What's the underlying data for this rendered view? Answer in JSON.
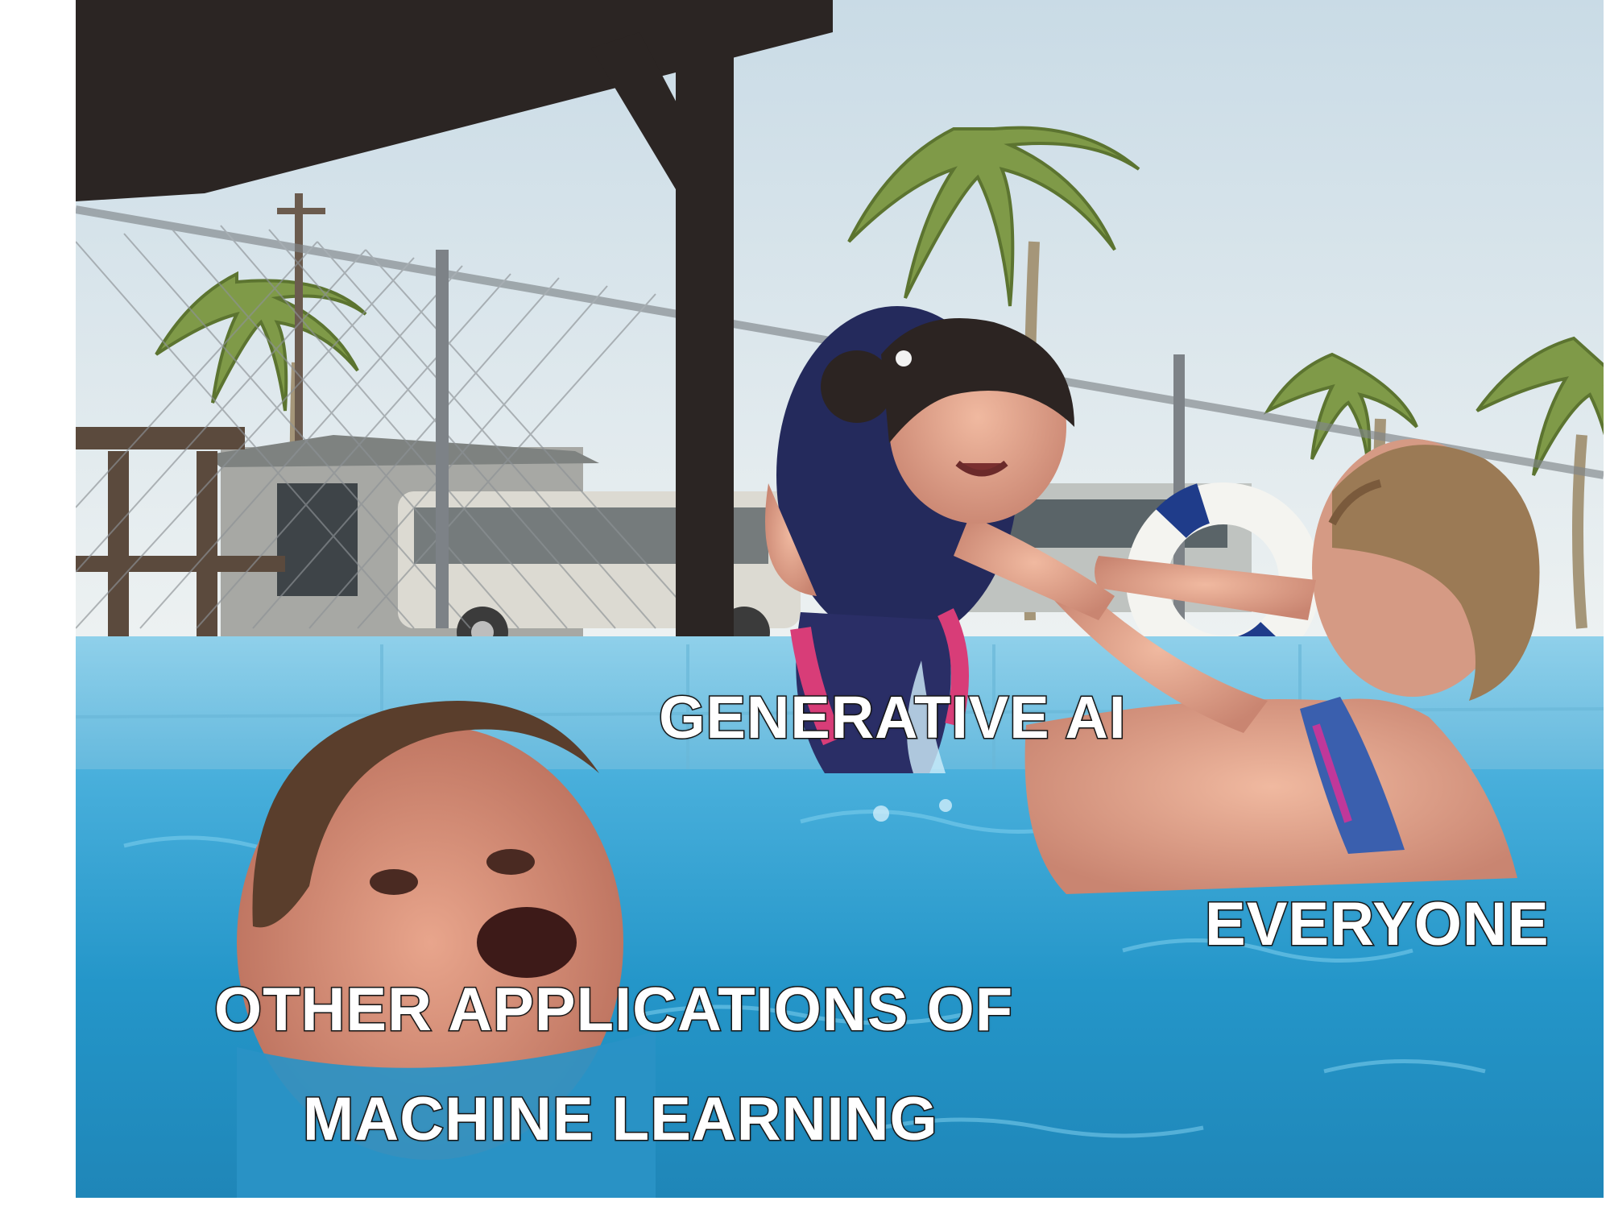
{
  "meme": {
    "captions": {
      "generative_ai": "GENERATIVE AI",
      "everyone": "EVERYONE",
      "other_line1": "OTHER APPLICATIONS OF",
      "other_line2": "MACHINE LEARNING"
    }
  },
  "colors": {
    "sky": "#dfe8ee",
    "pool_water": "#2f9fd0",
    "pool_wall": "#7cc6e3",
    "roof": "#2b2523",
    "fence": "#8a8f94",
    "palm": "#6f8a3a",
    "caption_fill": "#ffffff",
    "caption_outline": "#1a1a1a"
  }
}
